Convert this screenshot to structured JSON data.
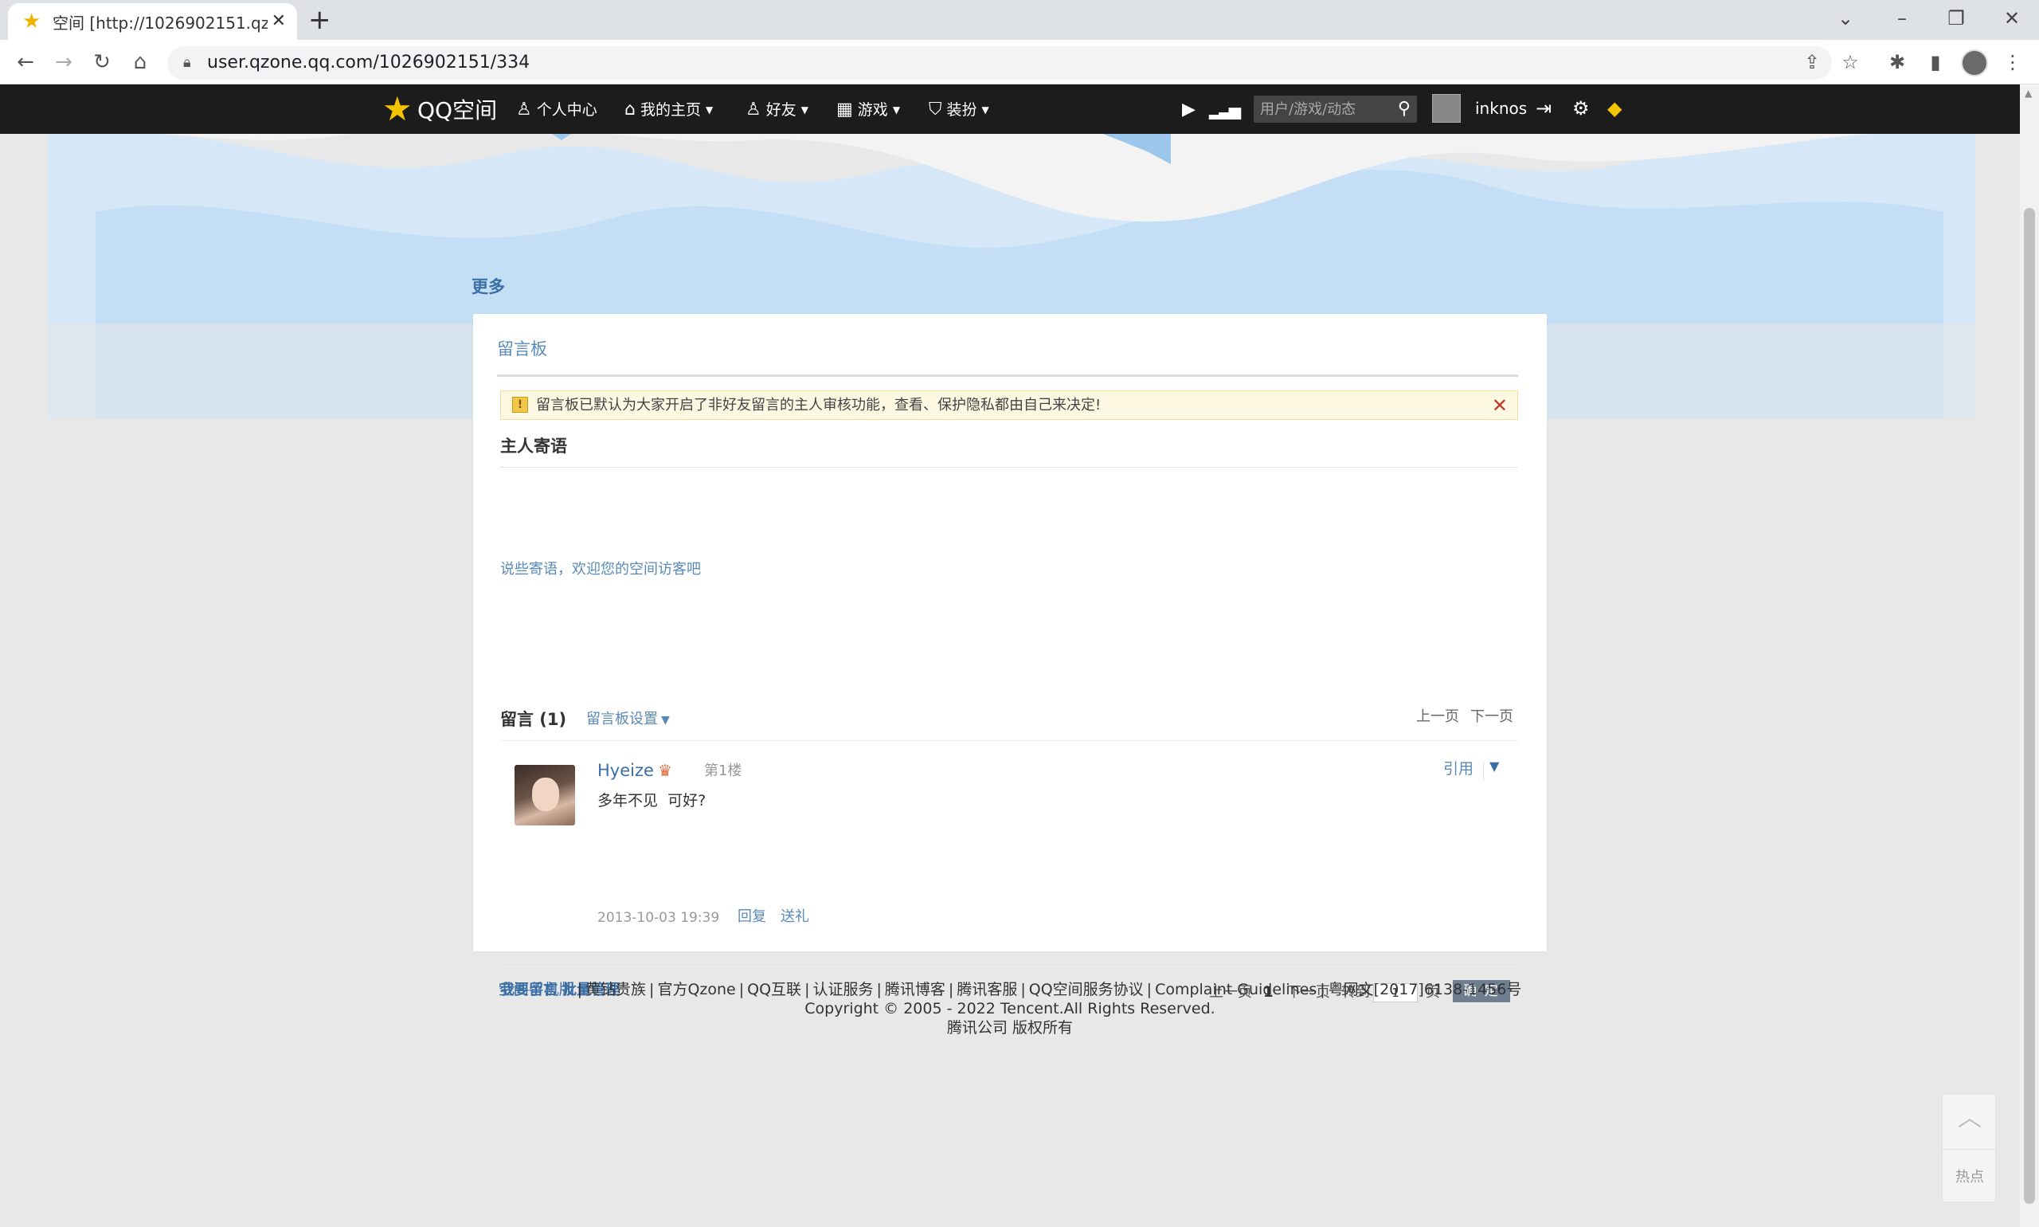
{
  "browser": {
    "tab_title": "空间 [http://1026902151.qzone",
    "url": "user.qzone.qq.com/1026902151/334"
  },
  "icons": {
    "tab_favicon": "star-icon",
    "back": "back-arrow-icon",
    "forward": "forward-arrow-icon",
    "reload": "reload-icon",
    "home": "home-icon",
    "lock": "lock-icon",
    "share": "share-icon",
    "bookmark": "star-outline-icon",
    "extensions": "puzzle-icon",
    "side_panel": "side-panel-icon"
  },
  "qzone_nav": {
    "logo_text": "QQ空间",
    "items": [
      {
        "label": "个人中心",
        "icon": "person-icon"
      },
      {
        "label": "我的主页",
        "icon": "home-icon"
      },
      {
        "label": "好友",
        "icon": "friends-icon"
      },
      {
        "label": "游戏",
        "icon": "grid-icon"
      },
      {
        "label": "装扮",
        "icon": "shirt-icon"
      }
    ],
    "search_placeholder": "用户/游戏/动态",
    "username": "inknos"
  },
  "more_link": "更多",
  "board": {
    "title": "留言板",
    "notice": "留言板已默认为大家开启了非好友留言的主人审核功能，查看、保护隐私都由自己来决定!",
    "host_title": "主人寄语",
    "host_text": "说些寄语，欢迎您的空间访客吧",
    "messages_heading": "留言 (1)",
    "settings_label": "留言板设置",
    "prev_page": "上一页",
    "next_page": "下一页"
  },
  "entry": {
    "author": "Hyeize",
    "floor": "第1楼",
    "quote": "引用",
    "content": "多年不见  可好?",
    "time": "2013-10-03 19:39",
    "reply": "回复",
    "gift": "送礼"
  },
  "board_footer": {
    "write": "我要留言",
    "batch": "批量管理",
    "prev": "上一页",
    "current": "1",
    "next": "下一页",
    "goto": "转到",
    "page_input": "1",
    "unit": "页",
    "confirm": "确 定"
  },
  "footer": {
    "links": [
      "空间手机版",
      "黄钻贵族",
      "官方Qzone",
      "QQ互联",
      "认证服务",
      "腾讯博客",
      "腾讯客服",
      "QQ空间服务协议",
      "Complaint Guidelines",
      "粤网文[2017]6138-1456号"
    ],
    "copyright": "Copyright © 2005 - 2022 Tencent.All Rights Reserved.",
    "company": "腾讯公司 版权所有"
  },
  "side": {
    "hot": "热点"
  },
  "colors": {
    "nav_bg": "#1c1c1c",
    "link_blue": "#3b6fa6",
    "banner_blue": "#bcdcf5",
    "notice_bg": "#fdf8e2"
  }
}
